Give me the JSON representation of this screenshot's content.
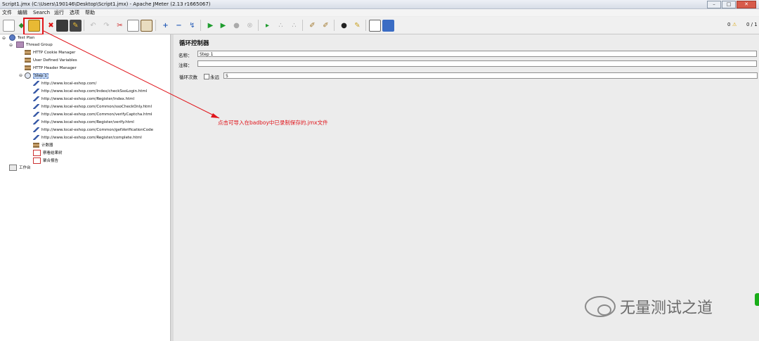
{
  "window": {
    "title": "Script1.jmx (C:\\Users\\190146\\Desktop\\Script1.jmx) - Apache JMeter (2.13 r1665067)",
    "buttons": [
      "–",
      "□",
      "✕"
    ]
  },
  "menu": [
    "文件",
    "编辑",
    "Search",
    "运行",
    "选项",
    "帮助"
  ],
  "toolbar": {
    "status_warning": "0",
    "status_threads": "0 / 1",
    "icons": [
      "new-icon",
      "templates-icon",
      "open-icon",
      "close-icon",
      "save-icon",
      "save-as-icon",
      "undo-icon",
      "redo-icon",
      "cut-icon",
      "copy-icon",
      "paste-icon",
      "expand-icon",
      "collapse-icon",
      "toggle-icon",
      "start-icon",
      "start-no-pause-icon",
      "stop-icon",
      "shutdown-icon",
      "remote-start-icon",
      "remote-stop-icon",
      "remote-shutdown-icon",
      "clear-icon",
      "clear-all-icon",
      "search-icon",
      "reset-search-icon",
      "function-helper-icon",
      "help-icon"
    ]
  },
  "tree": {
    "test_plan": "Test Plan",
    "thread_group": "Thread Group",
    "cookie_manager": "HTTP Cookie Manager",
    "user_vars": "User Defined Variables",
    "header_manager": "HTTP Header Manager",
    "step": "Step 1",
    "samplers": [
      "http://www.local-eshop.com/",
      "http://www.local-eshop.com/Index/checkSsoLogin.html",
      "http://www.local-eshop.com/Register/index.html",
      "http://www.local-eshop.com/Common/ssoCheckOnly.html",
      "http://www.local-eshop.com/Common/verifyCaptcha.html",
      "http://www.local-eshop.com/Register/verify.html",
      "http://www.local-eshop.com/Common/getVerificationCode",
      "http://www.local-eshop.com/Register/complete.html"
    ],
    "timer": "计数器",
    "results_tree": "察看结果树",
    "aggregate": "聚合报告",
    "workbench": "工作台"
  },
  "panel": {
    "title": "循环控制器",
    "name_label": "名称：",
    "name_value": "Step 1",
    "comment_label": "注释：",
    "comment_value": "",
    "loop_label": "循环次数",
    "forever_label": "永远",
    "loop_value": "5"
  },
  "annotation": "点击可导入在badboy中已录制保存的.jmx文件",
  "watermark": "无量测试之道"
}
